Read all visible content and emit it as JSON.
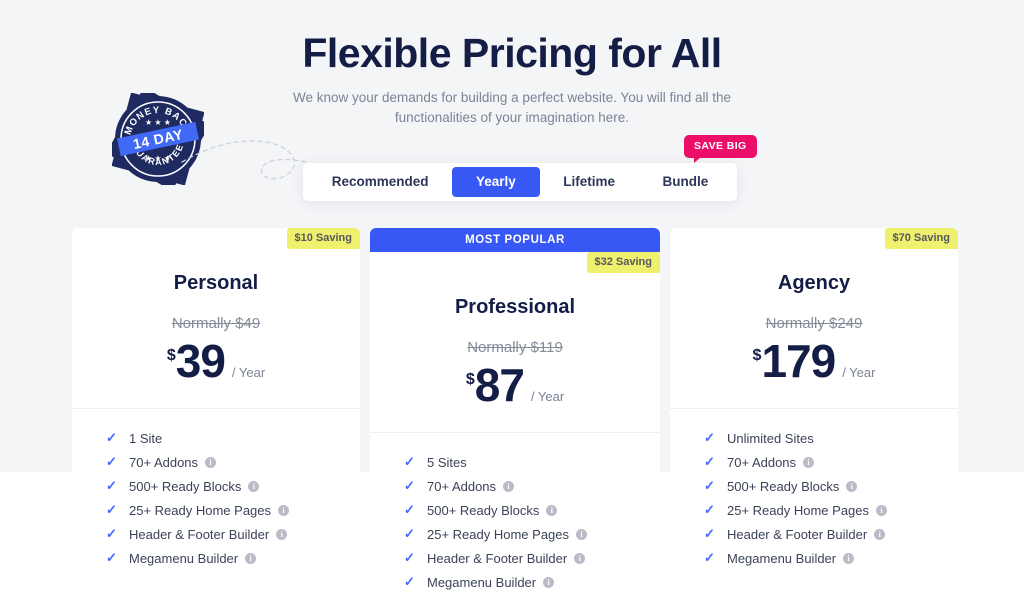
{
  "header": {
    "title": "Flexible Pricing for All",
    "subtitle": "We know your demands for building a perfect website. You will find all the functionalities of your imagination here."
  },
  "seal": {
    "top_text": "MONEY BACK",
    "bottom_text": "GUARANTEE",
    "ribbon_text": "14 DAY",
    "seal_color": "#1f2a60",
    "ribbon_color": "#4069f5"
  },
  "save_big_badge": {
    "label": "SAVE BIG",
    "color": "#ec0f69"
  },
  "tabs": [
    {
      "label": "Recommended",
      "active": false
    },
    {
      "label": "Yearly",
      "active": true
    },
    {
      "label": "Lifetime",
      "active": false
    },
    {
      "label": "Bundle",
      "active": false
    }
  ],
  "accent_color": "#3858f6",
  "plans": [
    {
      "name": "Personal",
      "saving_badge": "$10 Saving",
      "normally": "Normally $49",
      "currency": "$",
      "amount": "39",
      "period": "/ Year",
      "popular_label": "",
      "features": [
        {
          "label": "1 Site",
          "info": false
        },
        {
          "label": "70+ Addons",
          "info": true
        },
        {
          "label": "500+ Ready Blocks",
          "info": true
        },
        {
          "label": "25+ Ready Home Pages",
          "info": true
        },
        {
          "label": "Header & Footer Builder",
          "info": true
        },
        {
          "label": "Megamenu Builder",
          "info": true
        }
      ]
    },
    {
      "name": "Professional",
      "saving_badge": "$32 Saving",
      "normally": "Normally $119",
      "currency": "$",
      "amount": "87",
      "period": "/ Year",
      "popular_label": "MOST POPULAR",
      "features": [
        {
          "label": "5 Sites",
          "info": false
        },
        {
          "label": "70+ Addons",
          "info": true
        },
        {
          "label": "500+ Ready Blocks",
          "info": true
        },
        {
          "label": "25+ Ready Home Pages",
          "info": true
        },
        {
          "label": "Header & Footer Builder",
          "info": true
        },
        {
          "label": "Megamenu Builder",
          "info": true
        }
      ]
    },
    {
      "name": "Agency",
      "saving_badge": "$70 Saving",
      "normally": "Normally $249",
      "currency": "$",
      "amount": "179",
      "period": "/ Year",
      "popular_label": "",
      "features": [
        {
          "label": "Unlimited Sites",
          "info": false
        },
        {
          "label": "70+ Addons",
          "info": true
        },
        {
          "label": "500+ Ready Blocks",
          "info": true
        },
        {
          "label": "25+ Ready Home Pages",
          "info": true
        },
        {
          "label": "Header & Footer Builder",
          "info": true
        },
        {
          "label": "Megamenu Builder",
          "info": true
        }
      ]
    }
  ],
  "icons": {
    "check": "✓",
    "info": "i"
  }
}
